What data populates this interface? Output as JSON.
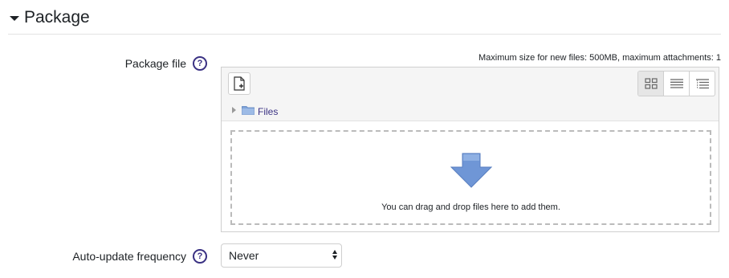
{
  "section": {
    "title": "Package"
  },
  "package_file": {
    "label": "Package file",
    "help_glyph": "?",
    "max_size_text": "Maximum size for new files: 500MB, maximum attachments: 1",
    "path_label": "Files",
    "drop_text": "You can drag and drop files here to add them.",
    "icons": [
      "add-file-icon",
      "view-icons-icon",
      "view-details-icon",
      "view-tree-icon",
      "folder-icon",
      "drop-arrow-icon"
    ]
  },
  "auto_update": {
    "label": "Auto-update frequency",
    "help_glyph": "?",
    "selected": "Never"
  },
  "colors": {
    "help_purple": "#3a3183",
    "folder_blue": "#7fa3d8",
    "drop_arrow_blue": "#6f96d6"
  }
}
